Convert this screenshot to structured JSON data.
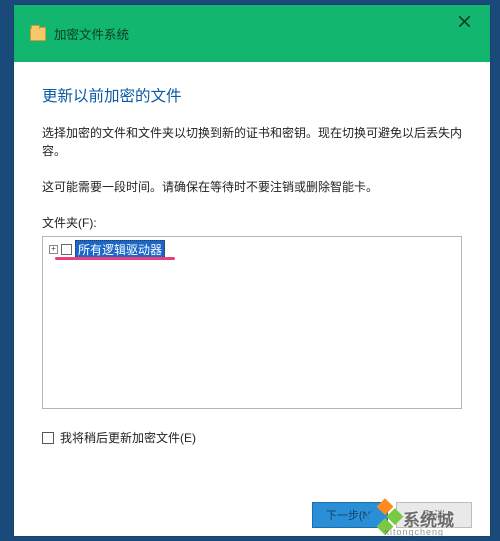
{
  "titlebar": {
    "title": "加密文件系统",
    "close_glyph": "×"
  },
  "content": {
    "heading": "更新以前加密的文件",
    "para1": "选择加密的文件和文件夹以切换到新的证书和密钥。现在切换可避免以后丢失内容。",
    "para2": "这可能需要一段时间。请确保在等待时不要注销或删除智能卡。",
    "folders_label": "文件夹(F):",
    "tree": {
      "root_label": "所有逻辑驱动器",
      "expander_glyph": "+"
    },
    "later_checkbox_label": "我将稍后更新加密文件(E)"
  },
  "footer": {
    "next_label": "下一步(N)",
    "cancel_label": "取消"
  },
  "watermark": {
    "text": "系统城",
    "sub": "xitongcheng"
  }
}
